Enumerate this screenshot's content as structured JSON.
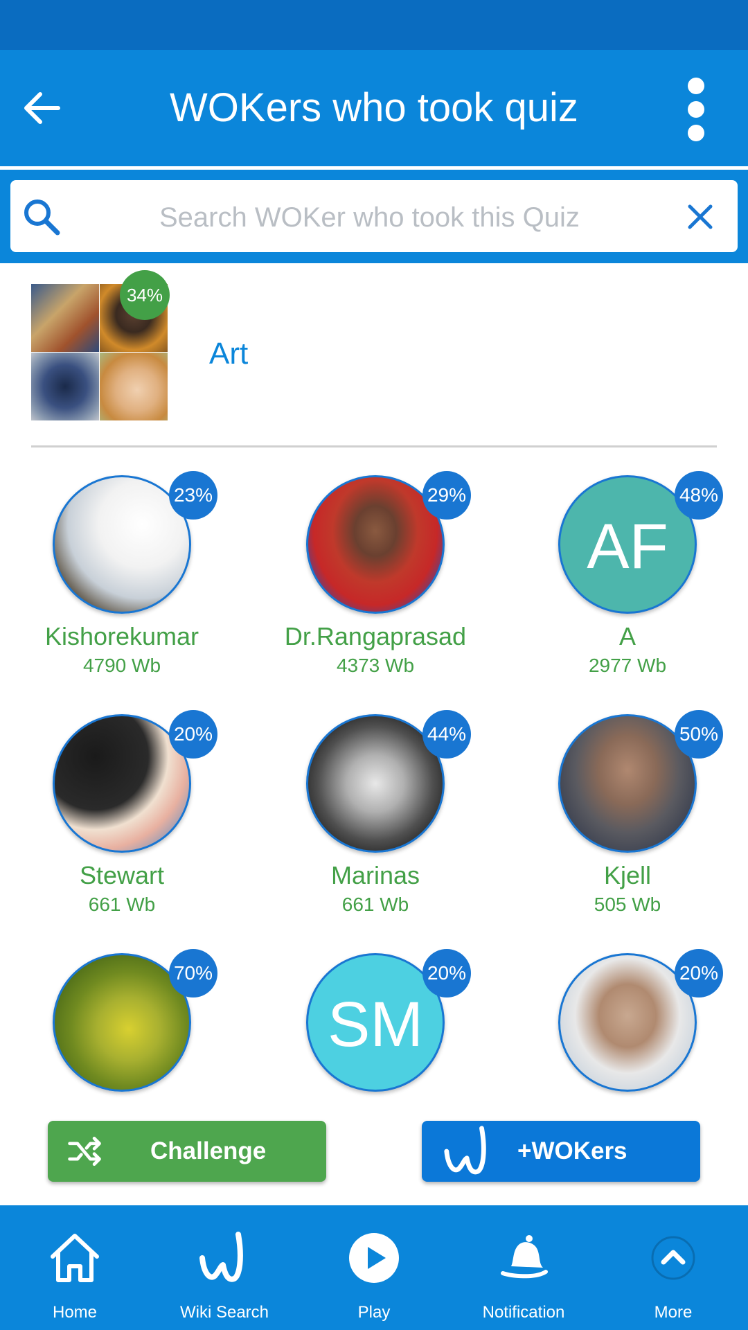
{
  "appbar": {
    "title": "WOKers who took quiz"
  },
  "search": {
    "placeholder": "Search WOKer who took this Quiz"
  },
  "quiz": {
    "name": "Art",
    "percent": "34%"
  },
  "users": [
    {
      "name": "Kishorekumar",
      "score": "4790 Wb",
      "percent": "23%"
    },
    {
      "name": "Dr.Rangaprasad",
      "score": "4373 Wb",
      "percent": "29%"
    },
    {
      "name": "A",
      "score": "2977 Wb",
      "percent": "48%",
      "initials": "AF",
      "avatar_color": "#4db6ac"
    },
    {
      "name": "Stewart",
      "score": "661 Wb",
      "percent": "20%"
    },
    {
      "name": "Marinas",
      "score": "661 Wb",
      "percent": "44%"
    },
    {
      "name": "Kjell",
      "score": "505 Wb",
      "percent": "50%"
    },
    {
      "name": "",
      "score": "",
      "percent": "70%"
    },
    {
      "name": "",
      "score": "",
      "percent": "20%",
      "initials": "SM",
      "avatar_color": "#4dd0e1"
    },
    {
      "name": "",
      "score": "",
      "percent": "20%"
    }
  ],
  "actions": {
    "challenge_label": "Challenge",
    "wokers_label": "+WOKers"
  },
  "nav": [
    {
      "label": "Home",
      "icon": "home-icon"
    },
    {
      "label": "Wiki Search",
      "icon": "wok-logo-icon"
    },
    {
      "label": "Play",
      "icon": "play-icon"
    },
    {
      "label": "Notification",
      "icon": "bell-icon"
    },
    {
      "label": "More",
      "icon": "chevron-up-icon"
    }
  ],
  "colors": {
    "primary": "#0b86da",
    "status_bar": "#0a6cc0",
    "green": "#43a047",
    "badge_blue": "#1976d2"
  }
}
